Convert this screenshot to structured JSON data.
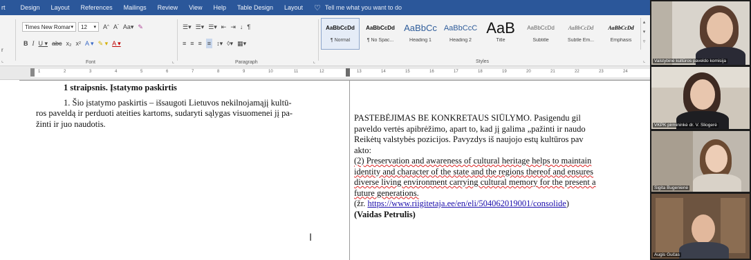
{
  "tabs": [
    {
      "label": "rt"
    },
    {
      "label": "Design"
    },
    {
      "label": "Layout"
    },
    {
      "label": "References"
    },
    {
      "label": "Mailings"
    },
    {
      "label": "Review"
    },
    {
      "label": "View"
    },
    {
      "label": "Help"
    },
    {
      "label": "Table Design"
    },
    {
      "label": "Layout"
    }
  ],
  "tell_me": "Tell me what you want to do",
  "font": {
    "name": "Times New Romar",
    "size": "12",
    "group_label": "Font"
  },
  "paragraph": {
    "group_label": "Paragraph"
  },
  "styles": {
    "group_label": "Styles",
    "items": [
      {
        "sample": "AaBbCcDd",
        "label": "¶ Normal"
      },
      {
        "sample": "AaBbCcDd",
        "label": "¶ No Spac..."
      },
      {
        "sample": "AaBbCc",
        "label": "Heading 1"
      },
      {
        "sample": "AaBbCcC",
        "label": "Heading 2"
      },
      {
        "sample": "AaB",
        "label": "Title"
      },
      {
        "sample": "AaBbCcDd",
        "label": "Subtitle"
      },
      {
        "sample": "AaBbCcDd",
        "label": "Subtle Em..."
      },
      {
        "sample": "AaBbCcDd",
        "label": "Emphasis"
      }
    ]
  },
  "ruler_numbers": [
    "1",
    "2",
    "3",
    "4",
    "5",
    "6",
    "7",
    "8",
    "9",
    "10",
    "11",
    "12",
    "13",
    "14",
    "15",
    "16",
    "17",
    "18",
    "19",
    "20",
    "21",
    "22",
    "23",
    "24"
  ],
  "document": {
    "left": {
      "heading": "1 straipsnis. Įstatymo paskirtis",
      "lines": [
        "1. Šio įstatymo paskirtis – išsaugoti Lietuvos nekilnojamąjį kultū-",
        "ros paveldą ir perduoti ateities kartoms, sudaryti sąlygas visuomenei jį pa-",
        "žinti ir juo naudotis."
      ]
    },
    "right": {
      "line1": "PASTEBĖJIMAS BE KONKRETAUS SIŪLYMO. Pasigendu gil",
      "line2": "paveldo vertės apibrėžimo, apart to, kad jį galima „pažinti ir naudo",
      "line3": "Reikėtų valstybės pozicijos. Pavyzdys iš naujojo estų kultūros pav",
      "line4": "akto:",
      "line5": "(2) Preservation and awareness of cultural heritage helps to maintain",
      "line6": "identity and character of the state and the regions thereof and ensures",
      "line7": "diverse living environment carrying cultural memory for the present a",
      "line8": "future generations.",
      "ref_prefix": "(žr. ",
      "ref_link": "https://www.riigitetaja.ee/en/eli/504062019001/consolide",
      "ref_suffix": ")",
      "author": "(Vaidas Petrulis)"
    }
  },
  "participants": [
    {
      "name": "Valstybinė kultūros paveldo komisija"
    },
    {
      "name": "VKPK pirmininkė dr. V. Šliogerė"
    },
    {
      "name": "Sigita Bugenienė"
    },
    {
      "name": "Augis Gučas"
    }
  ],
  "colors": {
    "accent": "#2b579a",
    "ribbon_bg": "#f3f3f3",
    "spellcheck": "#d22",
    "link": "#1a0dab"
  }
}
